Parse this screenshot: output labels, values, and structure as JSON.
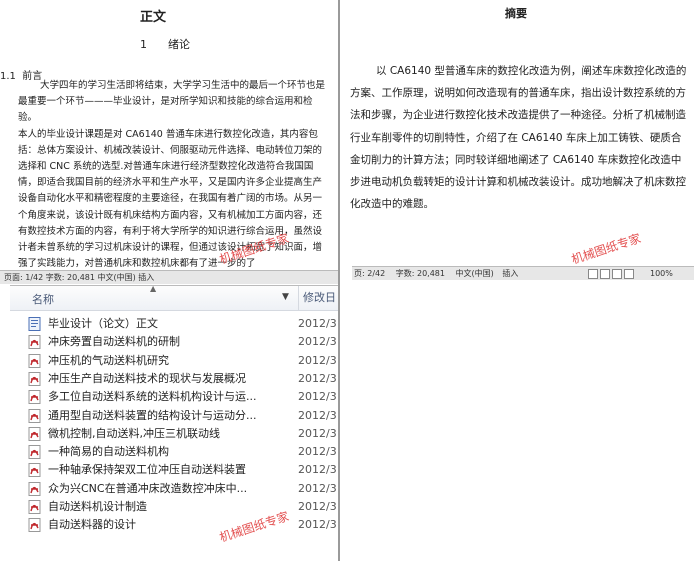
{
  "left_doc": {
    "title": "正文",
    "chapter": "1      绪论",
    "section": "1.1  前言",
    "para1": "大学四年的学习生活即将结束，大学学习生活中的最后一个环节也是最重要一个环节———毕业设计，是对所学知识和技能的综合运用和检验。",
    "para2": "本人的毕业设计课题是对 CA6140 普通车床进行数控化改造，其内容包括：总体方案设计、机械改装设计、伺服驱动元件选择、电动转位刀架的选择和 CNC 系统的选型.对普通车床进行经济型数控化改造符合我国国情，即适合我国目前的经济水平和生产水平，又是国内许多企业提高生产设备自动化水平和精密程度的主要途径，在我国有着广阔的市场。从另一个角度来说，该设计既有机床结构方面内容，又有机械加工方面内容，还有数控技术方面的内容，有利于将大学所学的知识进行综合运用，虽然设计者未曾系统的学习过机床设计的课程，但通过该设计拓宽了知识面，增强了实践能力，对普通机床和数控机床都有了进一步的了",
    "status": "页面: 1/42   字数: 20,481   中文(中国)   插入"
  },
  "explorer": {
    "col_name": "名称",
    "col_date": "修改日",
    "files": [
      {
        "name": "毕业设计（论文）正文",
        "date": "2012/3",
        "icon": "word-doc-icon"
      },
      {
        "name": "冲床旁置自动送料机的研制",
        "date": "2012/3",
        "icon": "pdf-icon"
      },
      {
        "name": "冲压机的气动送料机研究",
        "date": "2012/3",
        "icon": "pdf-icon"
      },
      {
        "name": "冲压生产自动送料技术的现状与发展概况",
        "date": "2012/3",
        "icon": "pdf-icon"
      },
      {
        "name": "多工位自动送料系统的送料机构设计与运...",
        "date": "2012/3",
        "icon": "pdf-icon"
      },
      {
        "name": "通用型自动送料装置的结构设计与运动分...",
        "date": "2012/3",
        "icon": "pdf-icon"
      },
      {
        "name": "微机控制,自动送料,冲压三机联动线",
        "date": "2012/3",
        "icon": "pdf-icon"
      },
      {
        "name": "一种简易的自动送料机构",
        "date": "2012/3",
        "icon": "pdf-icon"
      },
      {
        "name": "一种轴承保持架双工位冲压自动送料装置",
        "date": "2012/3",
        "icon": "pdf-icon"
      },
      {
        "name": "众为兴CNC在普通冲床改造数控冲床中...",
        "date": "2012/3",
        "icon": "pdf-icon"
      },
      {
        "name": "自动送料机设计制造",
        "date": "2012/3",
        "icon": "pdf-icon"
      },
      {
        "name": "自动送料器的设计",
        "date": "2012/3",
        "icon": "pdf-icon"
      }
    ]
  },
  "right_doc": {
    "title": "摘要",
    "body": "以 CA6140 型普通车床的数控化改造为例，阐述车床数控化改造的方案、工作原理，说明如何改造现有的普通车床，指出设计数控系统的方法和步骤，为企业进行数控化技术改造提供了一种途径。分析了机械制造行业车削零件的切削特性，介绍了在 CA6140 车床上加工铸铁、硬质合金切削力的计算方法；同时较详细地阐述了 CA6140 车床数控化改造中步进电动机负载转矩的设计计算和机械改装设计。成功地解决了机床数控化改造中的难题。",
    "status_page": "页: 2/42",
    "status_words": "字数: 20,481",
    "status_lang": "中文(中国)",
    "status_mode": "插入",
    "zoom": "100%"
  },
  "watermarks": [
    "机械图纸专家",
    "机械图纸专家",
    "机械图纸专家"
  ],
  "colors": {
    "watermark": "#e03c3c",
    "statusbar": "#e7e7e7"
  }
}
